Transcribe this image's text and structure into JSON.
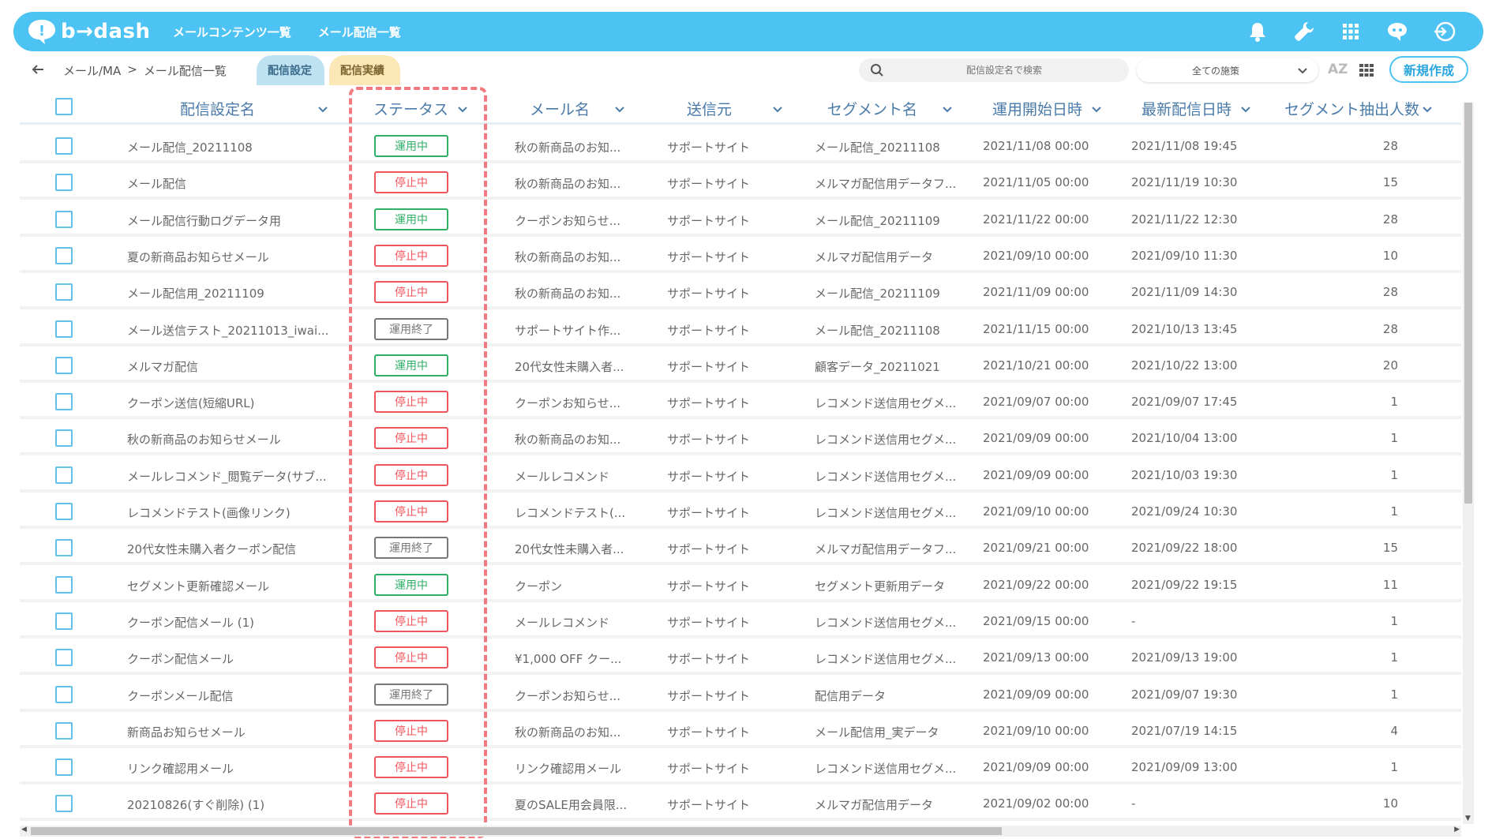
{
  "header": {
    "logo_text": "b→dash",
    "nav": [
      "メールコンテンツ一覧",
      "メール配信一覧"
    ],
    "icons": [
      "bell-icon",
      "wrench-icon",
      "apps-grid-icon",
      "chat-bot-icon",
      "logout-icon"
    ],
    "brand_color": "#4dc3f3"
  },
  "subbar": {
    "breadcrumb": [
      "メール/MA",
      ">",
      "メール配信一覧"
    ],
    "tabs": [
      "配信設定",
      "配信実績"
    ],
    "search_placeholder": "配信設定名で検索",
    "filter_value": "全ての施策",
    "sort_label": "AZ",
    "new_button": "新規作成"
  },
  "table": {
    "columns": [
      "配信設定名",
      "ステータス",
      "メール名",
      "送信元",
      "セグメント名",
      "運用開始日時",
      "最新配信日時",
      "セグメント抽出人数"
    ],
    "rows": [
      {
        "name": "メール配信_20211108",
        "status": "運用中",
        "status_type": "active",
        "mail": "秋の新商品のお知...",
        "sender": "サポートサイト",
        "segment": "メール配信_20211108",
        "start": "2021/11/08 00:00",
        "latest": "2021/11/08 19:45",
        "count": "28"
      },
      {
        "name": "メール配信",
        "status": "停止中",
        "status_type": "stopped",
        "mail": "秋の新商品のお知...",
        "sender": "サポートサイト",
        "segment": "メルマガ配信用データフ...",
        "start": "2021/11/05 00:00",
        "latest": "2021/11/19 10:30",
        "count": "15"
      },
      {
        "name": "メール配信行動ログデータ用",
        "status": "運用中",
        "status_type": "active",
        "mail": "クーポンお知らせ...",
        "sender": "サポートサイト",
        "segment": "メール配信_20211109",
        "start": "2021/11/22 00:00",
        "latest": "2021/11/22 12:30",
        "count": "28"
      },
      {
        "name": "夏の新商品お知らせメール",
        "status": "停止中",
        "status_type": "stopped",
        "mail": "秋の新商品のお知...",
        "sender": "サポートサイト",
        "segment": "メルマガ配信用データ",
        "start": "2021/09/10 00:00",
        "latest": "2021/09/10 11:30",
        "count": "10"
      },
      {
        "name": "メール配信用_20211109",
        "status": "停止中",
        "status_type": "stopped",
        "mail": "秋の新商品のお知...",
        "sender": "サポートサイト",
        "segment": "メール配信_20211109",
        "start": "2021/11/09 00:00",
        "latest": "2021/11/09 14:30",
        "count": "28"
      },
      {
        "name": "メール送信テスト_20211013_iwai...",
        "status": "運用終了",
        "status_type": "ended",
        "mail": "サポートサイト作...",
        "sender": "サポートサイト",
        "segment": "メール配信_20211108",
        "start": "2021/11/15 00:00",
        "latest": "2021/10/13 13:45",
        "count": "28"
      },
      {
        "name": "メルマガ配信",
        "status": "運用中",
        "status_type": "active",
        "mail": "20代女性未購入者...",
        "sender": "サポートサイト",
        "segment": "顧客データ_20211021",
        "start": "2021/10/21 00:00",
        "latest": "2021/10/22 13:00",
        "count": "20"
      },
      {
        "name": "クーポン送信(短縮URL)",
        "status": "停止中",
        "status_type": "stopped",
        "mail": "クーポンお知らせ...",
        "sender": "サポートサイト",
        "segment": "レコメンド送信用セグメ...",
        "start": "2021/09/07 00:00",
        "latest": "2021/09/07 17:45",
        "count": "1"
      },
      {
        "name": "秋の新商品のお知らせメール",
        "status": "停止中",
        "status_type": "stopped",
        "mail": "秋の新商品のお知...",
        "sender": "サポートサイト",
        "segment": "レコメンド送信用セグメ...",
        "start": "2021/09/09 00:00",
        "latest": "2021/10/04 13:00",
        "count": "1"
      },
      {
        "name": "メールレコメンド_閲覧データ(サブ...",
        "status": "停止中",
        "status_type": "stopped",
        "mail": "メールレコメンド",
        "sender": "サポートサイト",
        "segment": "レコメンド送信用セグメ...",
        "start": "2021/09/09 00:00",
        "latest": "2021/10/03 19:30",
        "count": "1"
      },
      {
        "name": "レコメンドテスト(画像リンク)",
        "status": "停止中",
        "status_type": "stopped",
        "mail": "レコメンドテスト(...",
        "sender": "サポートサイト",
        "segment": "レコメンド送信用セグメ...",
        "start": "2021/09/10 00:00",
        "latest": "2021/09/24 10:30",
        "count": "1"
      },
      {
        "name": "20代女性未購入者クーポン配信",
        "status": "運用終了",
        "status_type": "ended",
        "mail": "20代女性未購入者...",
        "sender": "サポートサイト",
        "segment": "メルマガ配信用データフ...",
        "start": "2021/09/21 00:00",
        "latest": "2021/09/22 18:00",
        "count": "15"
      },
      {
        "name": "セグメント更新確認メール",
        "status": "運用中",
        "status_type": "active",
        "mail": "クーポン",
        "sender": "サポートサイト",
        "segment": "セグメント更新用データ",
        "start": "2021/09/22 00:00",
        "latest": "2021/09/22 19:15",
        "count": "11"
      },
      {
        "name": "クーポン配信メール (1)",
        "status": "停止中",
        "status_type": "stopped",
        "mail": "メールレコメンド",
        "sender": "サポートサイト",
        "segment": "レコメンド送信用セグメ...",
        "start": "2021/09/15 00:00",
        "latest": "-",
        "count": "1"
      },
      {
        "name": "クーポン配信メール",
        "status": "停止中",
        "status_type": "stopped",
        "mail": "¥1,000 OFF クー...",
        "sender": "サポートサイト",
        "segment": "レコメンド送信用セグメ...",
        "start": "2021/09/13 00:00",
        "latest": "2021/09/13 19:00",
        "count": "1"
      },
      {
        "name": "クーポンメール配信",
        "status": "運用終了",
        "status_type": "ended",
        "mail": "クーポンお知らせ...",
        "sender": "サポートサイト",
        "segment": "配信用データ",
        "start": "2021/09/09 00:00",
        "latest": "2021/09/07 19:30",
        "count": "1"
      },
      {
        "name": "新商品お知らせメール",
        "status": "停止中",
        "status_type": "stopped",
        "mail": "秋の新商品のお知...",
        "sender": "サポートサイト",
        "segment": "メール配信用_実データ",
        "start": "2021/09/10 00:00",
        "latest": "2021/07/19 14:15",
        "count": "4"
      },
      {
        "name": "リンク確認用メール",
        "status": "停止中",
        "status_type": "stopped",
        "mail": "リンク確認用メール",
        "sender": "サポートサイト",
        "segment": "レコメンド送信用セグメ...",
        "start": "2021/09/09 00:00",
        "latest": "2021/09/09 13:00",
        "count": "1"
      },
      {
        "name": "20210826(すぐ削除) (1)",
        "status": "停止中",
        "status_type": "stopped",
        "mail": "夏のSALE用会員限...",
        "sender": "サポートサイト",
        "segment": "メルマガ配信用データ",
        "start": "2021/09/02 00:00",
        "latest": "-",
        "count": "10"
      }
    ]
  },
  "status_colors": {
    "active": "#2fae66",
    "stopped": "#f0545c",
    "ended": "#777777"
  },
  "highlight_color": "#f07a80"
}
